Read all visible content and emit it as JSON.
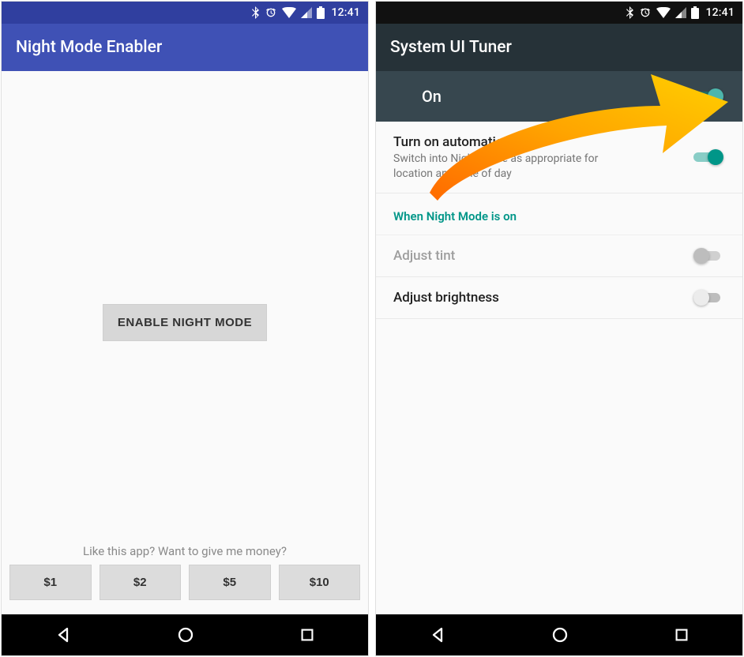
{
  "status": {
    "time": "12:41"
  },
  "left": {
    "title": "Night Mode Enabler",
    "enableButton": "ENABLE NIGHT MODE",
    "likeText": "Like this app? Want to give me money?",
    "donations": [
      "$1",
      "$2",
      "$5",
      "$10"
    ]
  },
  "right": {
    "title": "System UI Tuner",
    "onLabel": "On",
    "auto": {
      "title": "Turn on automatically",
      "sub": "Switch into Night Mode as appropriate for location and time of day"
    },
    "sectionHeader": "When Night Mode is on",
    "tint": {
      "title": "Adjust tint"
    },
    "brightness": {
      "title": "Adjust brightness"
    }
  }
}
